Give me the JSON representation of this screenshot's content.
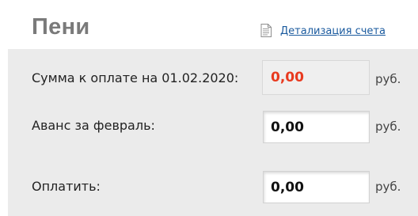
{
  "header": {
    "title": "Пени",
    "details_link": "Детализация счета",
    "details_icon": "document-icon"
  },
  "rows": {
    "due": {
      "label": "Сумма к оплате на 01.02.2020:",
      "value": "0,00",
      "unit": "руб.",
      "value_color": "#e83a1f"
    },
    "advance": {
      "label": "Аванс за февраль:",
      "value": "0,00",
      "unit": "руб."
    },
    "pay": {
      "label": "Оплатить:",
      "value": "0,00",
      "unit": "руб."
    }
  }
}
